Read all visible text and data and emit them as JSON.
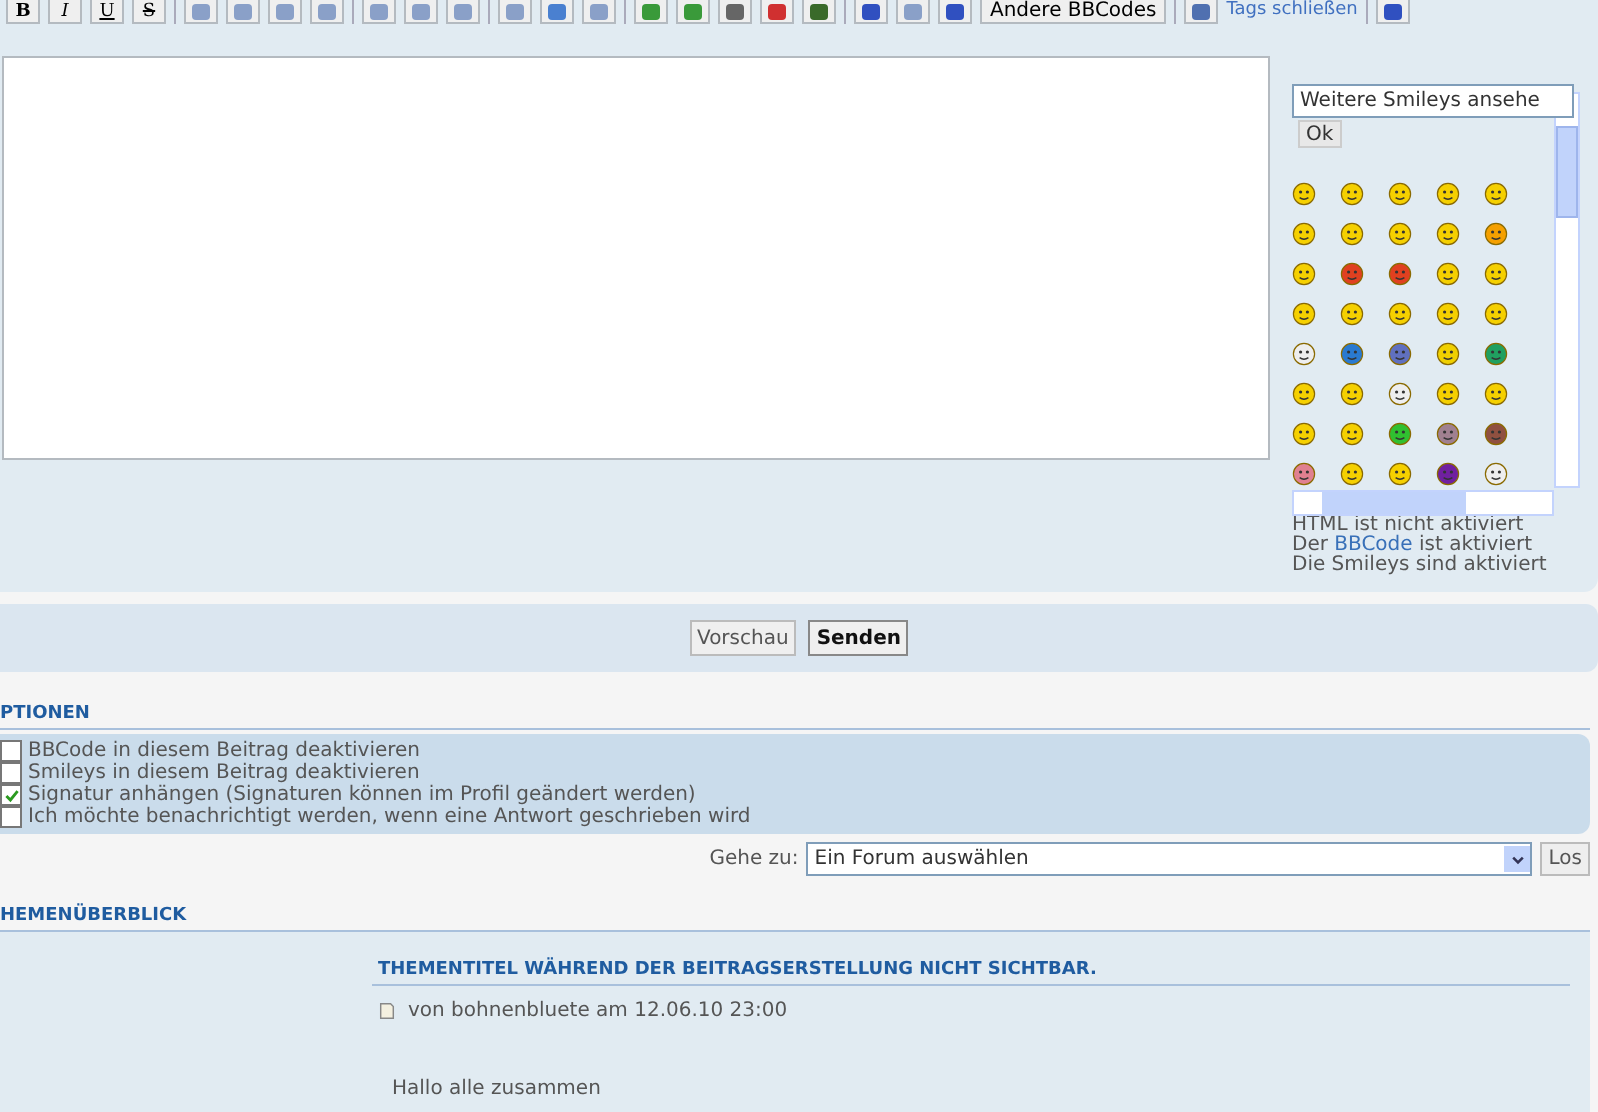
{
  "toolbar": [
    {
      "kind": "letter",
      "label": "B"
    },
    {
      "kind": "letter",
      "label": "I"
    },
    {
      "kind": "letter",
      "label": "U"
    },
    {
      "kind": "letter",
      "label": "S"
    },
    {
      "kind": "sep"
    },
    {
      "kind": "icon"
    },
    {
      "kind": "icon"
    },
    {
      "kind": "icon"
    },
    {
      "kind": "icon"
    },
    {
      "kind": "sep"
    },
    {
      "kind": "icon"
    },
    {
      "kind": "icon"
    },
    {
      "kind": "icon"
    },
    {
      "kind": "sep"
    },
    {
      "kind": "icon"
    },
    {
      "kind": "icon"
    },
    {
      "kind": "icon"
    },
    {
      "kind": "sep"
    },
    {
      "kind": "icon"
    },
    {
      "kind": "icon"
    },
    {
      "kind": "icon"
    },
    {
      "kind": "icon"
    },
    {
      "kind": "icon"
    },
    {
      "kind": "sep"
    },
    {
      "kind": "icon"
    },
    {
      "kind": "icon"
    },
    {
      "kind": "icon"
    },
    {
      "kind": "text",
      "label": "Andere BBCodes"
    },
    {
      "kind": "sep"
    },
    {
      "kind": "icon"
    },
    {
      "kind": "link",
      "label": "Tags schließen"
    },
    {
      "kind": "sep"
    },
    {
      "kind": "icon"
    }
  ],
  "smiley_panel": {
    "select": "Weitere Smileys ansehe",
    "ok_button": "Ok",
    "status_lines": [
      {
        "text": "HTML ist nicht aktiviert"
      },
      {
        "text": "Der ",
        "link": "BBCode",
        "after": " ist aktiviert"
      },
      {
        "text": "Die Smileys sind aktiviert"
      }
    ]
  },
  "buttons": [
    {
      "label": "Vorschau",
      "primary": false
    },
    {
      "label": "Senden",
      "primary": true
    }
  ],
  "options": {
    "heading": "PTIONEN",
    "items": [
      {
        "label": "BBCode in diesem Beitrag deaktivieren",
        "checked": false
      },
      {
        "label": "Smileys in diesem Beitrag deaktivieren",
        "checked": false
      },
      {
        "label": "Signatur anhängen (Signaturen können im Profil geändert werden)",
        "checked": true
      },
      {
        "label": "Ich möchte benachrichtigt werden, wenn eine Antwort geschrieben wird",
        "checked": false
      }
    ]
  },
  "jump": {
    "label": "Gehe zu:",
    "select": "Ein Forum auswählen",
    "button": "Los"
  },
  "topic_review": {
    "heading": "HEMENÜBERBLICK",
    "post_title": "THEMENTITEL WÄHREND DER BEITRAGSERSTELLUNG NICHT SICHTBAR.",
    "meta": "von bohnenbluete am 12.06.10 23:00",
    "body": "Hallo alle zusammen"
  }
}
